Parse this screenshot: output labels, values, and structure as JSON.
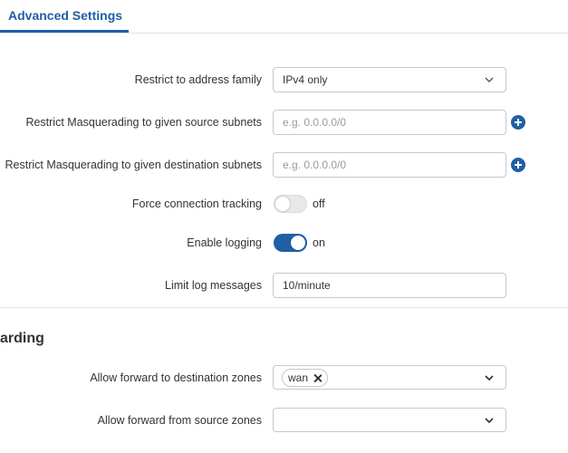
{
  "tabs": [
    {
      "label": "Advanced Settings",
      "active": true
    }
  ],
  "accent_color": "#1f5fa6",
  "settings": {
    "address_family": {
      "label": "Restrict to address family",
      "value": "IPv4 only"
    },
    "masq_src": {
      "label": "Restrict Masquerading to given source subnets",
      "placeholder": "e.g. 0.0.0.0/0",
      "value": ""
    },
    "masq_dest": {
      "label": "Restrict Masquerading to given destination subnets",
      "placeholder": "e.g. 0.0.0.0/0",
      "value": ""
    },
    "conntrack": {
      "label": "Force connection tracking",
      "state": "off"
    },
    "logging": {
      "label": "Enable logging",
      "state": "on"
    },
    "log_limit": {
      "label": "Limit log messages",
      "value": "10/minute"
    }
  },
  "forwarding": {
    "title": "arding",
    "dest_zones": {
      "label": "Allow forward to destination zones",
      "selected": [
        "wan"
      ]
    },
    "src_zones": {
      "label": "Allow forward from source zones",
      "selected": []
    }
  }
}
